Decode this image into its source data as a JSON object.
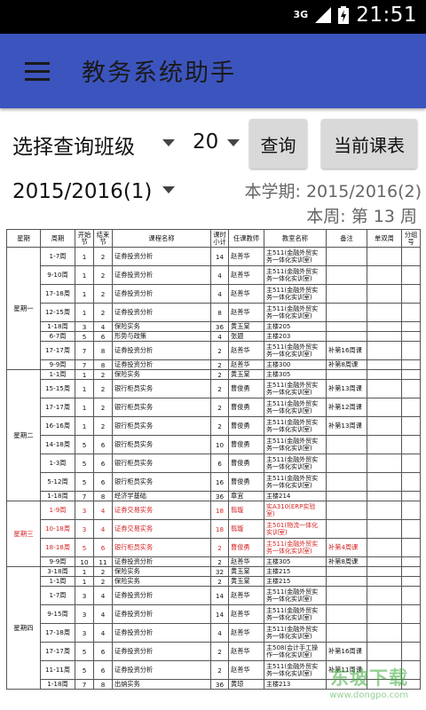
{
  "status": {
    "network": "3G",
    "time": "21:51"
  },
  "app": {
    "title": "教务系统助手",
    "menu_icon": "menu-icon"
  },
  "controls": {
    "class_select_label": "选择查询班级",
    "count_value": "20",
    "query_button": "查询",
    "current_button": "当前课表",
    "term_value": "2015/2016(1)",
    "current_term": "本学期: 2015/2016(2)",
    "current_week": "本周: 第 13 周"
  },
  "colors": {
    "appbar": "#3c54be",
    "highlight": "#d42626"
  },
  "table": {
    "headers": [
      "星期",
      "周期",
      "开始节",
      "结束节",
      "课程名称",
      "课时小计",
      "任课教师",
      "教室名称",
      "备注",
      "单双周",
      "分组号"
    ],
    "days": [
      "星期一",
      "星期二",
      "星期三",
      "星期四"
    ],
    "rows": [
      [
        "1-7周",
        "1",
        "2",
        "证券投资分析",
        "14",
        "赵善华",
        "主511(金融外贸实务一体化实训室)",
        ""
      ],
      [
        "9-10周",
        "1",
        "2",
        "证券投资分析",
        "4",
        "赵善华",
        "主511(金融外贸实务一体化实训室)",
        ""
      ],
      [
        "17-18周",
        "1",
        "2",
        "证券投资分析",
        "4",
        "赵善华",
        "主511(金融外贸实务一体化实训室)",
        ""
      ],
      [
        "12-15周",
        "1",
        "2",
        "证券投资分析",
        "8",
        "赵善华",
        "主511(金融外贸实务一体化实训室)",
        ""
      ],
      [
        "1-18周",
        "3",
        "4",
        "保险实务",
        "36",
        "黄玉棠",
        "主楼205",
        ""
      ],
      [
        "6-7周",
        "5",
        "6",
        "形势与政策",
        "4",
        "张题",
        "主楼203",
        ""
      ],
      [
        "17-17周",
        "7",
        "8",
        "证券投资分析",
        "2",
        "赵善华",
        "主511(金融外贸实务一体化实训室)",
        "补第16周课"
      ],
      [
        "9-9周",
        "7",
        "8",
        "证券投资分析",
        "2",
        "赵善华",
        "主楼300",
        "补第8周课"
      ],
      [
        "1-1周",
        "1",
        "2",
        "保险实务",
        "2",
        "黄玉棠",
        "主楼305",
        ""
      ],
      [
        "15-15周",
        "1",
        "2",
        "银行柜员实务",
        "2",
        "曹俊勇",
        "主511(金融外贸实务一体化实训室)",
        "补第13周课"
      ],
      [
        "17-17周",
        "1",
        "2",
        "银行柜员实务",
        "2",
        "曹俊勇",
        "主511(金融外贸实务一体化实训室)",
        "补第12周课"
      ],
      [
        "16-16周",
        "1",
        "2",
        "银行柜员实务",
        "2",
        "曹俊勇",
        "主511(金融外贸实务一体化实训室)",
        "补第13周课"
      ],
      [
        "14-18周",
        "5",
        "6",
        "银行柜员实务",
        "10",
        "曹俊勇",
        "主511(金融外贸实务一体化实训室)",
        ""
      ],
      [
        "1-3周",
        "5",
        "6",
        "银行柜员实务",
        "6",
        "曹俊勇",
        "主511(金融外贸实务一体化实训室)",
        ""
      ],
      [
        "5-12周",
        "5",
        "6",
        "银行柜员实务",
        "16",
        "曹俊勇",
        "主511(金融外贸实务一体化实训室)",
        ""
      ],
      [
        "1-18周",
        "7",
        "8",
        "经济学基础",
        "36",
        "章宜",
        "主楼214",
        ""
      ],
      [
        "1-9周",
        "3",
        "4",
        "证券交易实务",
        "18",
        "翦璇",
        "实A310(ERP实验室)",
        ""
      ],
      [
        "10-18周",
        "3",
        "4",
        "证券交易实务",
        "18",
        "翦璇",
        "主501(物流一体化实训室)",
        ""
      ],
      [
        "18-18周",
        "5",
        "6",
        "银行柜员实务",
        "2",
        "曹俊勇",
        "主511(金融外贸实务一体化实训室)",
        "补第4周课"
      ],
      [
        "9-9周",
        "10",
        "11",
        "证券投资分析",
        "2",
        "赵善华",
        "主楼305",
        "补第8周课"
      ],
      [
        "3-18周",
        "1",
        "2",
        "保险实务",
        "32",
        "黄玉棠",
        "主楼215",
        ""
      ],
      [
        "1-1周",
        "1",
        "2",
        "保险实务",
        "2",
        "黄玉棠",
        "主楼215",
        ""
      ],
      [
        "1-7周",
        "3",
        "4",
        "证券投资分析",
        "14",
        "赵善华",
        "主511(金融外贸实务一体化实训室)",
        ""
      ],
      [
        "9-15周",
        "3",
        "4",
        "证券投资分析",
        "14",
        "赵善华",
        "主511(金融外贸实务一体化实训室)",
        ""
      ],
      [
        "17-18周",
        "3",
        "4",
        "证券投资分析",
        "4",
        "赵善华",
        "主511(金融外贸实务一体化实训室)",
        ""
      ],
      [
        "17-17周",
        "5",
        "6",
        "证券投资分析",
        "2",
        "赵善华",
        "主508(会计手工操作一体化实训室)",
        "补第16周课"
      ],
      [
        "11-11周",
        "5",
        "6",
        "证券投资分析",
        "2",
        "赵善华",
        "主511(金融外贸实务一体化实训室)",
        "补第11周课"
      ],
      [
        "1-18周",
        "7",
        "8",
        "出纳实务",
        "36",
        "黄琼",
        "主楼213",
        ""
      ]
    ]
  },
  "watermark": {
    "line1": "东坡下载",
    "line2": "www.dongpo.com"
  }
}
